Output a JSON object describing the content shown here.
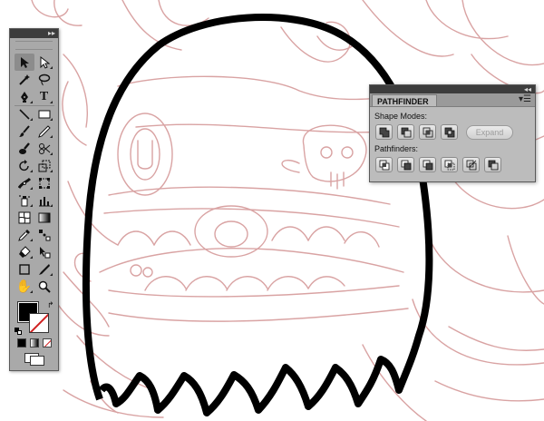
{
  "colors": {
    "sketch_line": "#d9a3a3",
    "ink": "#000000",
    "panel_bg": "#a9a9a9",
    "panel_title": "#3c3c3c"
  },
  "tools_panel": {
    "title_icon": "double-chevron-icon",
    "tools": [
      "selection-tool-icon",
      "direct-selection-tool-icon",
      "magic-wand-tool-icon",
      "lasso-tool-icon",
      "pen-tool-icon",
      "type-tool-icon",
      "line-segment-tool-icon",
      "rectangle-tool-icon",
      "paintbrush-tool-icon",
      "pencil-tool-icon",
      "blob-brush-tool-icon",
      "eraser-tool-icon",
      "rotate-tool-icon",
      "scale-tool-icon",
      "width-tool-icon",
      "free-transform-tool-icon",
      "symbol-sprayer-tool-icon",
      "column-graph-tool-icon",
      "mesh-tool-icon",
      "gradient-tool-icon",
      "eyedropper-tool-icon",
      "blend-tool-icon",
      "live-paint-bucket-tool-icon",
      "live-paint-selection-tool-icon",
      "artboard-tool-icon",
      "slice-tool-icon",
      "hand-tool-icon",
      "zoom-tool-icon"
    ]
  },
  "pathfinder_panel": {
    "tab_label": "PATHFINDER",
    "shape_modes_label": "Shape Modes:",
    "pathfinders_label": "Pathfinders:",
    "expand_label": "Expand",
    "shape_mode_buttons": [
      "unite-icon",
      "minus-front-icon",
      "intersect-icon",
      "exclude-icon"
    ],
    "pathfinder_buttons": [
      "divide-icon",
      "trim-icon",
      "merge-icon",
      "crop-icon",
      "outline-icon",
      "minus-back-icon"
    ]
  }
}
